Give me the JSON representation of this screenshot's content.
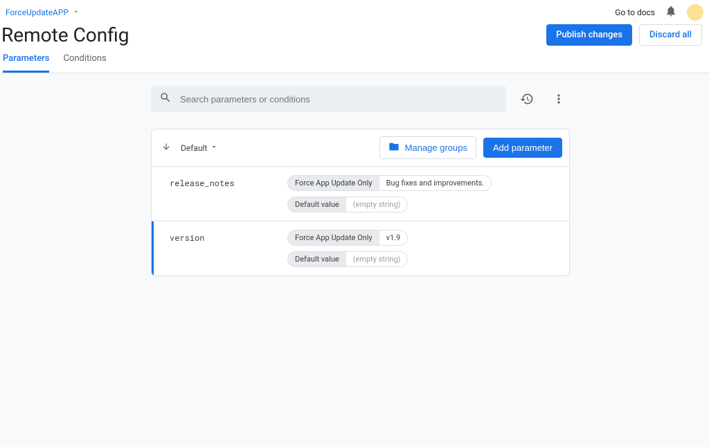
{
  "project": {
    "name": "ForceUpdateAPP"
  },
  "header": {
    "docs_link": "Go to docs",
    "title": "Remote Config",
    "publish_label": "Publish changes",
    "discard_label": "Discard all"
  },
  "tabs": [
    {
      "label": "Parameters",
      "active": true
    },
    {
      "label": "Conditions",
      "active": false
    }
  ],
  "search": {
    "placeholder": "Search parameters or conditions"
  },
  "toolbar": {
    "sort_label": "Default",
    "manage_groups_label": "Manage groups",
    "add_parameter_label": "Add parameter"
  },
  "parameters": [
    {
      "name": "release_notes",
      "selected": false,
      "values": [
        {
          "condition": "Force App Update Only",
          "value": "Bug fixes and improvements.",
          "empty": false
        },
        {
          "condition": "Default value",
          "value": "(empty string)",
          "empty": true
        }
      ]
    },
    {
      "name": "version",
      "selected": true,
      "values": [
        {
          "condition": "Force App Update Only",
          "value": "v1.9",
          "empty": false
        },
        {
          "condition": "Default value",
          "value": "(empty string)",
          "empty": true
        }
      ]
    }
  ]
}
